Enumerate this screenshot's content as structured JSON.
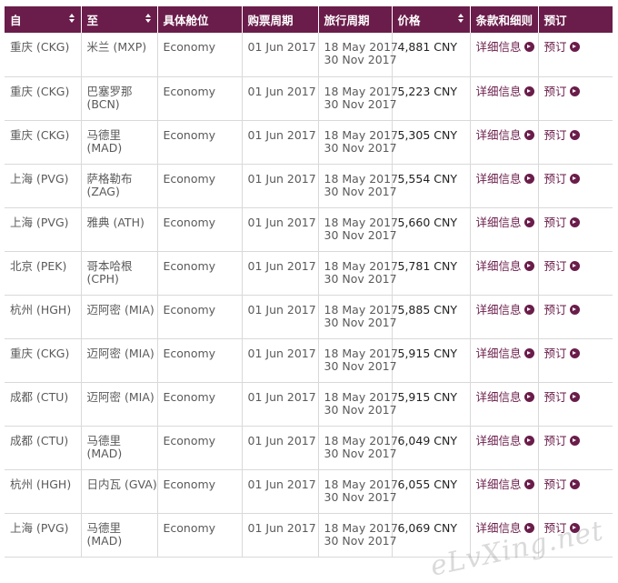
{
  "table": {
    "headers": [
      {
        "label": "自",
        "sortable": true
      },
      {
        "label": "至",
        "sortable": true
      },
      {
        "label": "具体舱位",
        "sortable": false
      },
      {
        "label": "购票周期",
        "sortable": false
      },
      {
        "label": "旅行周期",
        "sortable": false
      },
      {
        "label": "价格",
        "sortable": true
      },
      {
        "label": "条款和细则",
        "sortable": false
      },
      {
        "label": "预订",
        "sortable": false
      }
    ],
    "rows": [
      {
        "from": "重庆 (CKG)",
        "to1": "米兰 (MXP)",
        "to2": "",
        "cabin": "Economy",
        "purchase": "01 Jun 2017",
        "travel_start": "18 May 2017",
        "travel_end": "30 Nov 2017",
        "price": "4,881 CNY",
        "details": "详细信息",
        "book": "预订"
      },
      {
        "from": "重庆 (CKG)",
        "to1": "巴塞罗那",
        "to2": "(BCN)",
        "cabin": "Economy",
        "purchase": "01 Jun 2017",
        "travel_start": "18 May 2017",
        "travel_end": "30 Nov 2017",
        "price": "5,223 CNY",
        "details": "详细信息",
        "book": "预订"
      },
      {
        "from": "重庆 (CKG)",
        "to1": "马德里",
        "to2": "(MAD)",
        "cabin": "Economy",
        "purchase": "01 Jun 2017",
        "travel_start": "18 May 2017",
        "travel_end": "30 Nov 2017",
        "price": "5,305 CNY",
        "details": "详细信息",
        "book": "预订"
      },
      {
        "from": "上海 (PVG)",
        "to1": "萨格勒布",
        "to2": "(ZAG)",
        "cabin": "Economy",
        "purchase": "01 Jun 2017",
        "travel_start": "18 May 2017",
        "travel_end": "30 Nov 2017",
        "price": "5,554 CNY",
        "details": "详细信息",
        "book": "预订"
      },
      {
        "from": "上海 (PVG)",
        "to1": "雅典 (ATH)",
        "to2": "",
        "cabin": "Economy",
        "purchase": "01 Jun 2017",
        "travel_start": "18 May 2017",
        "travel_end": "30 Nov 2017",
        "price": "5,660 CNY",
        "details": "详细信息",
        "book": "预订"
      },
      {
        "from": "北京 (PEK)",
        "to1": "哥本哈根",
        "to2": "(CPH)",
        "cabin": "Economy",
        "purchase": "01 Jun 2017",
        "travel_start": "18 May 2017",
        "travel_end": "30 Nov 2017",
        "price": "5,781 CNY",
        "details": "详细信息",
        "book": "预订"
      },
      {
        "from": "杭州 (HGH)",
        "to1": "迈阿密 (MIA)",
        "to2": "",
        "cabin": "Economy",
        "purchase": "01 Jun 2017",
        "travel_start": "18 May 2017",
        "travel_end": "30 Nov 2017",
        "price": "5,885 CNY",
        "details": "详细信息",
        "book": "预订"
      },
      {
        "from": "重庆 (CKG)",
        "to1": "迈阿密 (MIA)",
        "to2": "",
        "cabin": "Economy",
        "purchase": "01 Jun 2017",
        "travel_start": "18 May 2017",
        "travel_end": "30 Nov 2017",
        "price": "5,915 CNY",
        "details": "详细信息",
        "book": "预订"
      },
      {
        "from": "成都 (CTU)",
        "to1": "迈阿密 (MIA)",
        "to2": "",
        "cabin": "Economy",
        "purchase": "01 Jun 2017",
        "travel_start": "18 May 2017",
        "travel_end": "30 Nov 2017",
        "price": "5,915 CNY",
        "details": "详细信息",
        "book": "预订"
      },
      {
        "from": "成都 (CTU)",
        "to1": "马德里",
        "to2": "(MAD)",
        "cabin": "Economy",
        "purchase": "01 Jun 2017",
        "travel_start": "18 May 2017",
        "travel_end": "30 Nov 2017",
        "price": "6,049 CNY",
        "details": "详细信息",
        "book": "预订"
      },
      {
        "from": "杭州 (HGH)",
        "to1": "日内瓦 (GVA)",
        "to2": "",
        "cabin": "Economy",
        "purchase": "01 Jun 2017",
        "travel_start": "18 May 2017",
        "travel_end": "30 Nov 2017",
        "price": "6,055 CNY",
        "details": "详细信息",
        "book": "预订"
      },
      {
        "from": "上海 (PVG)",
        "to1": "马德里",
        "to2": "(MAD)",
        "cabin": "Economy",
        "purchase": "01 Jun 2017",
        "travel_start": "18 May 2017",
        "travel_end": "30 Nov 2017",
        "price": "6,069 CNY",
        "details": "详细信息",
        "book": "预订"
      }
    ]
  },
  "watermark": "eLvXing.net",
  "colors": {
    "header_bg": "#6a1d4a",
    "link": "#6a1d4a",
    "border": "#d9d9d9"
  }
}
